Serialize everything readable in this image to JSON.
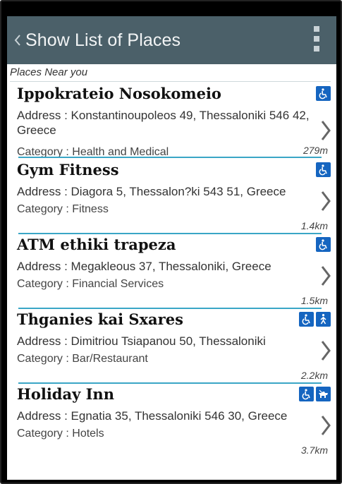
{
  "appbar": {
    "title": "Show List of Places"
  },
  "section": {
    "header": "Places Near you"
  },
  "places": [
    {
      "name": "Ippokrateio Nosokomeio",
      "address": "Address : Konstantinoupoleos 49, Thessaloniki 546 42, Greece",
      "category": "Category : Health and Medical",
      "distance": "279m",
      "badges": [
        "wheelchair-icon"
      ]
    },
    {
      "name": "Gym Fitness",
      "address": "Address : Diagora 5, Thessalon?ki 543 51, Greece",
      "category": "Category : Fitness",
      "distance": "1.4km",
      "badges": [
        "wheelchair-icon"
      ]
    },
    {
      "name": "ATM ethiki trapeza",
      "address": "Address : Megakleous 37, Thessaloniki, Greece",
      "category": "Category : Financial Services",
      "distance": "1.5km",
      "badges": [
        "wheelchair-icon"
      ]
    },
    {
      "name": "Thganies kai Sxares",
      "address": "Address : Dimitriou Tsiapanou 50, Thessaloniki",
      "category": "Category : Bar/Restaurant",
      "distance": "2.2km",
      "badges": [
        "wheelchair-icon",
        "pedestrian-icon"
      ]
    },
    {
      "name": "Holiday Inn",
      "address": "Address : Egnatia 35, Thessaloniki 546 30, Greece",
      "category": "Category : Hotels",
      "distance": "3.7km",
      "badges": [
        "wheelchair-icon",
        "guide-dog-icon"
      ]
    }
  ],
  "colors": {
    "appbar": "#4b6069",
    "divider": "#3aa6c6",
    "badge": "#1565c0"
  }
}
